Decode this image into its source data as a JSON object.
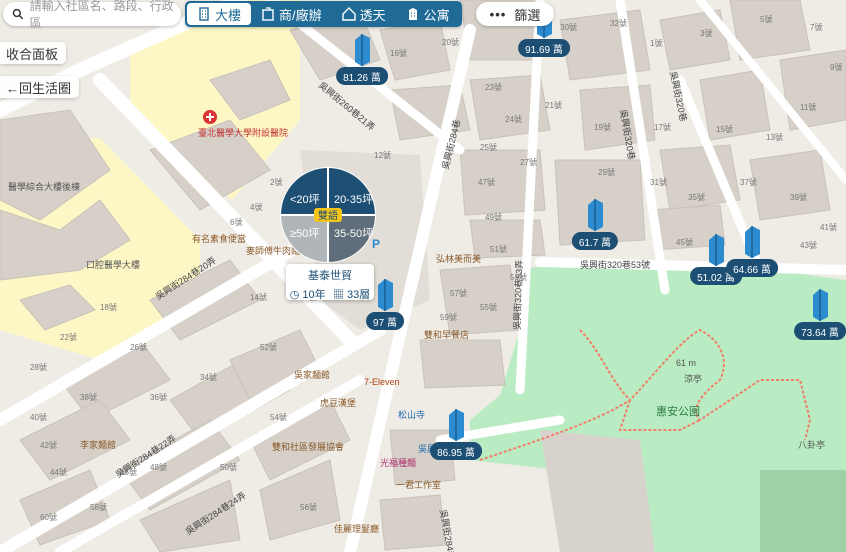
{
  "search": {
    "placeholder": "請輸入社區名、路段、行政區"
  },
  "tabs": [
    {
      "label": "大樓",
      "icon": "building-icon",
      "active": true
    },
    {
      "label": "商/廠辦",
      "icon": "office-icon",
      "active": false
    },
    {
      "label": "透天",
      "icon": "house-icon",
      "active": false
    },
    {
      "label": "公寓",
      "icon": "apartment-icon",
      "active": false
    }
  ],
  "filter": {
    "label": "篩選",
    "icon": "more-dots-icon"
  },
  "side_buttons": {
    "collapse": "收合面板",
    "back": "←回生活圈"
  },
  "colors": {
    "brand": "#1f6b96",
    "price_tag": "#1d4f74",
    "park": "#b9ecc2",
    "pin": "#2d8bd0"
  },
  "radial_menu": {
    "segments": [
      "<20坪",
      "20-35坪",
      "≥50坪",
      "35-50坪"
    ],
    "center_label": "雙語"
  },
  "community_card": {
    "name": "基泰世貿",
    "age": "10年",
    "units": "33層"
  },
  "listings": [
    {
      "price": "91.69 萬"
    },
    {
      "price": "81.26 萬"
    },
    {
      "price": "61.7 萬"
    },
    {
      "price": "51.02 萬"
    },
    {
      "price": "64.66 萬"
    },
    {
      "price": "73.64 萬"
    },
    {
      "price": "97 萬"
    },
    {
      "price": "86.95 萬"
    }
  ],
  "streets": {
    "s1": "吳興街260巷21弄",
    "s2": "吳興街284巷",
    "s3": "吳興街284巷20弄",
    "s4": "吳興街284巷22弄",
    "s5": "吳興街284巷24弄",
    "s6": "吳興街320巷53弄",
    "s7": "吳興街320巷53號",
    "s8": "吳興街320巷",
    "s9": "吳興街320巷",
    "s10": "吳興街284巷"
  },
  "places": {
    "hospital": "臺北醫學大學附設醫院",
    "tmu_building": "醫學綜合大樓後棟",
    "tmu_hall": "口腔醫學大樓",
    "park": "惠安公園",
    "seven": "7-Eleven",
    "songshan_temple": "松山寺",
    "pavilion": "八卦亭",
    "shop1": "有名素食便當",
    "shop2": "麥師傅牛肉麵分館",
    "shop3": "吳家麵館",
    "shop4": "虎豆漢堡",
    "shop5": "李家麵館",
    "shop6": "雙和社區發展協會",
    "shop7": "光福種麵",
    "shop8": "吳興社",
    "shop9": "雙和早餐店",
    "shop10": "弘林美而美",
    "shop11": "佳麗理髮廳",
    "shop12": "一君工作室",
    "elev": "61 m",
    "shrine": "涼亭"
  },
  "house_numbers": [
    "12號",
    "16號",
    "20號",
    "23號",
    "24號",
    "30號",
    "32號",
    "1號",
    "3號",
    "5號",
    "7號",
    "9號",
    "11號",
    "13號",
    "15號",
    "17號",
    "19號",
    "21號",
    "25號",
    "27號",
    "29號",
    "31號",
    "35號",
    "37號",
    "39號",
    "41號",
    "43號",
    "45號",
    "47號",
    "49號",
    "51號",
    "53號",
    "55號",
    "57號",
    "59號",
    "2號",
    "4號",
    "6號",
    "8號",
    "10號",
    "14號",
    "18號",
    "22號",
    "26號",
    "28號",
    "34號",
    "36號",
    "38號",
    "40號",
    "42號",
    "44號",
    "46號",
    "48號",
    "50號",
    "52號",
    "54號",
    "56號",
    "58號",
    "60號"
  ]
}
